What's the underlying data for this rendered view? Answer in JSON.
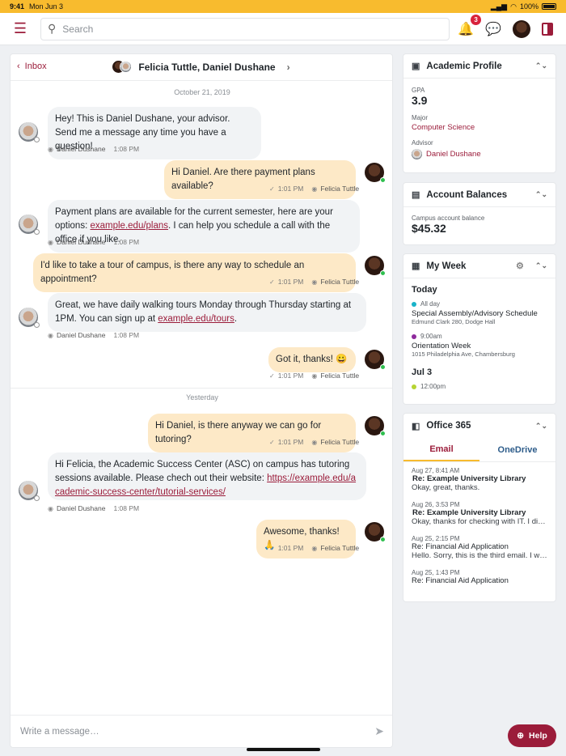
{
  "status_bar": {
    "time": "9:41",
    "date": "Mon Jun 3",
    "battery": "100%"
  },
  "header": {
    "search_placeholder": "Search",
    "notifications_count": "3",
    "icons": [
      "hamburger-menu-icon",
      "search-icon",
      "bell-icon",
      "chat-icon",
      "profile-avatar",
      "side-panel-icon"
    ]
  },
  "chat": {
    "back_label": "Inbox",
    "title": "Felicia Tuttle, Daniel Dushane",
    "date_1": "October 21, 2019",
    "date_2": "Yesterday",
    "composer_placeholder": "Write a message…",
    "messages": [
      {
        "dir": "in",
        "text": "Hey! This is Daniel Dushane, your advisor.\nSend me a message any time you have a question!",
        "sender": "Daniel Dushane",
        "time": "1:08 PM"
      },
      {
        "dir": "out",
        "text": "Hi Daniel. Are there payment plans available?",
        "sender": "Felicia Tuttle",
        "time": "1:01 PM"
      },
      {
        "dir": "in",
        "text_before": "Payment plans are available for the current semester, here are your options: ",
        "link": "example.edu/plans",
        "text_after": ". I can help you schedule a call with the office if you like.",
        "sender": "Daniel Dushane",
        "time": "1:08 PM"
      },
      {
        "dir": "out",
        "text": "I'd like to take a tour of campus, is there any way to schedule an appointment?",
        "sender": "Felicia Tuttle",
        "time": "1:01 PM"
      },
      {
        "dir": "in",
        "text_before": "Great, we have daily walking tours Monday through Thursday starting at 1PM. You can sign up at ",
        "link": "example.edu/tours",
        "text_after": ".",
        "sender": "Daniel Dushane",
        "time": "1:08 PM"
      },
      {
        "dir": "out",
        "text": "Got it, thanks! 😀",
        "sender": "Felicia Tuttle",
        "time": "1:01 PM"
      },
      {
        "dir": "out",
        "text": "Hi Daniel, is there anyway we can go for tutoring?",
        "sender": "Felicia Tuttle",
        "time": "1:01 PM"
      },
      {
        "dir": "in",
        "text_before": "Hi Felicia, the Academic Success Center (ASC) on campus has tutoring sessions available. Please chech out their website: ",
        "link": "https://example.edu/academic-success-center/tutorial-services/",
        "text_after": "",
        "sender": "Daniel Dushane",
        "time": "1:08 PM"
      },
      {
        "dir": "out",
        "text": "Awesome, thanks! 🙏",
        "sender": "Felicia Tuttle",
        "time": "1:01 PM"
      }
    ]
  },
  "academic_profile": {
    "title": "Academic Profile",
    "gpa_label": "GPA",
    "gpa": "3.9",
    "major_label": "Major",
    "major": "Computer Science",
    "advisor_label": "Advisor",
    "advisor": "Daniel Dushane"
  },
  "account_balances": {
    "title": "Account Balances",
    "label": "Campus account balance",
    "amount": "$45.32"
  },
  "my_week": {
    "title": "My Week",
    "today_label": "Today",
    "events": [
      {
        "time": "All day",
        "title": "Special Assembly/Advisory Schedule",
        "location": "Edmund Clark 280, Dodge Hall",
        "color": "#19b3c9"
      },
      {
        "time": "9:00am",
        "title": "Orientation Week",
        "location": "1015 Philadelphia Ave, Chambersburg",
        "color": "#8e2a9c"
      }
    ],
    "day2_label": "Jul 3",
    "day2_event_time": "12:00pm",
    "day2_event_color": "#b6d433"
  },
  "office365": {
    "title": "Office 365",
    "tabs": [
      "Email",
      "OneDrive"
    ],
    "emails": [
      {
        "date": "Aug 27, 8:41 AM",
        "subject": "Re: Example University Library",
        "preview": "Okay, great, thanks.",
        "unread": true
      },
      {
        "date": "Aug 26, 3:53 PM",
        "subject": "Re: Example University Library",
        "preview": "Okay, thanks for checking with IT. I didn't...",
        "unread": true
      },
      {
        "date": "Aug 25, 2:15 PM",
        "subject": "Re: Financial Aid Application",
        "preview": "Hello. Sorry, this is the third email. I was...",
        "unread": false
      },
      {
        "date": "Aug 25, 1:43 PM",
        "subject": "Re: Financial Aid Application",
        "preview": "",
        "unread": false
      }
    ]
  },
  "help_label": "Help",
  "colors": {
    "brand": "#9b1c3a",
    "accent": "#f8bb2e",
    "outgoing_bubble": "#fde9c7",
    "incoming_bubble": "#f1f3f5"
  }
}
